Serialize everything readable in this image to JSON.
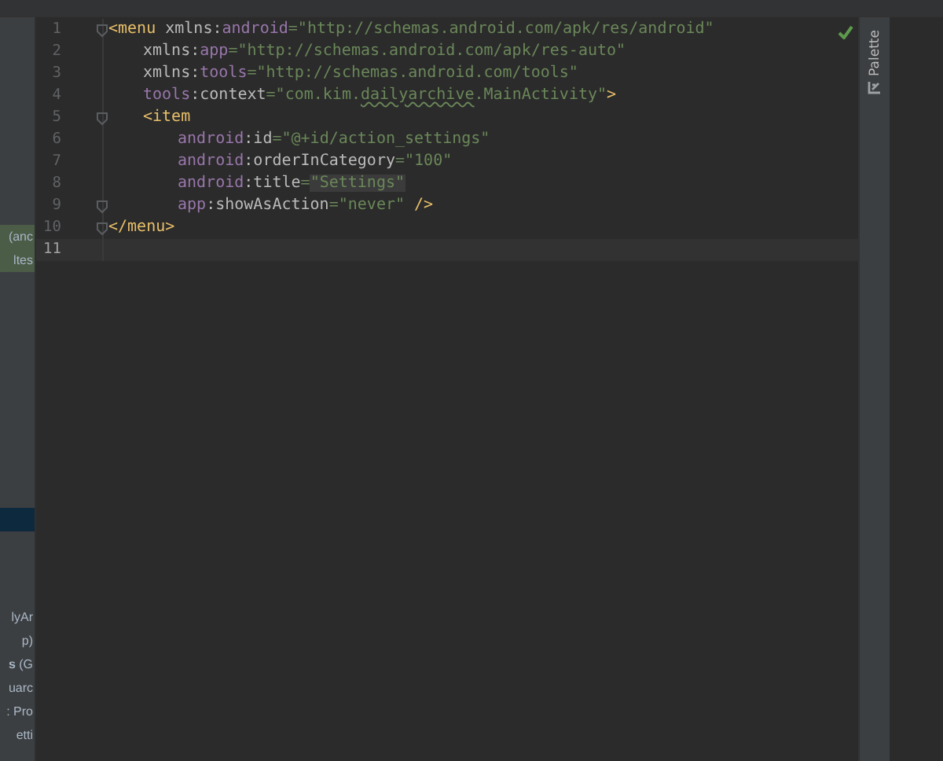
{
  "project_panel": {
    "items": [
      {
        "text": "(anc",
        "highlighted": true
      },
      {
        "text": "ltes",
        "highlighted": true
      },
      {
        "text": "lyAr",
        "highlighted": false
      },
      {
        "text": "p)",
        "highlighted": false
      },
      {
        "text": "**s** (G",
        "highlighted": false
      },
      {
        "text": "uarc",
        "highlighted": false
      },
      {
        "text": ": Pro",
        "highlighted": false
      },
      {
        "text": "etti",
        "highlighted": false
      }
    ]
  },
  "editor": {
    "lines": [
      {
        "number": "1",
        "fold": true,
        "current": false,
        "tokens": [
          {
            "kind": "tag",
            "text": "<menu "
          },
          {
            "kind": "name",
            "text": "xmlns:"
          },
          {
            "kind": "ns",
            "text": "android"
          },
          {
            "kind": "value",
            "text": "=\"http://schemas.android.com/apk/res/android\""
          }
        ],
        "children": [
          {
            "number": "2",
            "fold": false,
            "current": false,
            "tokens": [
              {
                "kind": "name",
                "text": "xmlns:"
              },
              {
                "kind": "ns",
                "text": "app"
              },
              {
                "kind": "value",
                "text": "=\"http://schemas.android.com/apk/res-auto\""
              }
            ]
          },
          {
            "number": "3",
            "fold": false,
            "current": false,
            "tokens": [
              {
                "kind": "name",
                "text": "xmlns:"
              },
              {
                "kind": "ns",
                "text": "tools"
              },
              {
                "kind": "value",
                "text": "=\"http://schemas.android.com/tools\""
              }
            ]
          },
          {
            "number": "4",
            "fold": false,
            "current": false,
            "tokens": [
              {
                "kind": "ns",
                "text": "tools"
              },
              {
                "kind": "name",
                "text": ":context"
              },
              {
                "kind": "value",
                "text": "=\"com.kim."
              },
              {
                "kind": "typo",
                "text": "dailyarchive"
              },
              {
                "kind": "value",
                "text": ".MainActivity\""
              },
              {
                "kind": "tag",
                "text": ">"
              }
            ]
          },
          {
            "number": "5",
            "fold": true,
            "current": false,
            "tokens": [
              {
                "kind": "tag",
                "text": "<item"
              }
            ],
            "children": [
              {
                "number": "6",
                "fold": false,
                "current": false,
                "tokens": [
                  {
                    "kind": "ns",
                    "text": "android"
                  },
                  {
                    "kind": "name",
                    "text": ":id"
                  },
                  {
                    "kind": "value",
                    "text": "=\"@+id/action_settings\""
                  }
                ]
              },
              {
                "number": "7",
                "fold": false,
                "current": false,
                "tokens": [
                  {
                    "kind": "ns",
                    "text": "android"
                  },
                  {
                    "kind": "name",
                    "text": ":orderInCategory"
                  },
                  {
                    "kind": "value",
                    "text": "=\"100\""
                  }
                ]
              },
              {
                "number": "8",
                "fold": false,
                "current": false,
                "tokens": [
                  {
                    "kind": "ns",
                    "text": "android"
                  },
                  {
                    "kind": "name",
                    "text": ":title"
                  },
                  {
                    "kind": "value",
                    "text": "="
                  },
                  {
                    "kind": "literal",
                    "text": "\"Settings\""
                  }
                ]
              },
              {
                "number": "9",
                "fold": true,
                "current": false,
                "tokens": [
                  {
                    "kind": "ns",
                    "text": "app"
                  },
                  {
                    "kind": "name",
                    "text": ":showAsAction"
                  },
                  {
                    "kind": "value",
                    "text": "=\"never\" "
                  },
                  {
                    "kind": "tag",
                    "text": "/>"
                  }
                ]
              }
            ]
          }
        ]
      },
      {
        "number": "10",
        "fold": true,
        "current": false,
        "tokens": [
          {
            "kind": "tag",
            "text": "</menu>"
          }
        ]
      },
      {
        "number": "11",
        "fold": false,
        "current": true
      }
    ]
  },
  "right_strip": {
    "tabs": [
      {
        "label": "Palette",
        "selected": false
      }
    ]
  }
}
